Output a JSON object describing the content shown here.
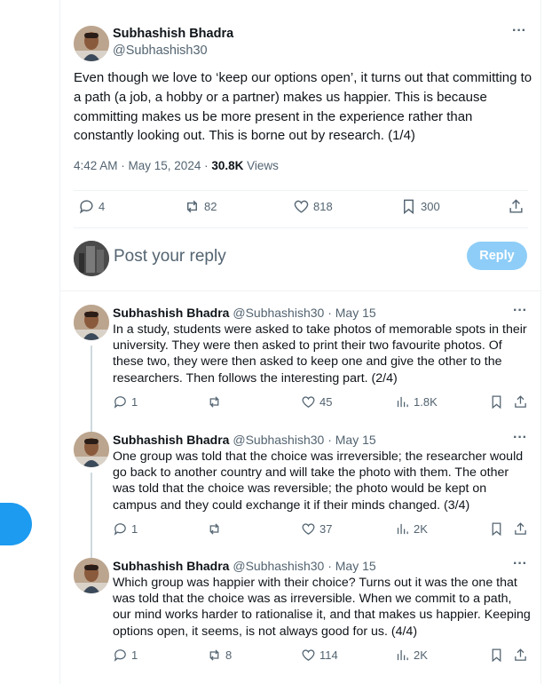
{
  "main_tweet": {
    "author_name": "Subhashish Bhadra",
    "author_handle": "@Subhashish30",
    "text": "Even though we love to ‘keep our options open’, it turns out that committing to a path (a job, a hobby or a partner) makes us happier. This is because committing makes us be more present in the experience rather than constantly looking out. This is borne out by research. (1/4)",
    "time": "4:42 AM · May 15, 2024 · ",
    "views_count": "30.8K",
    "views_label": " Views",
    "stats": {
      "replies": "4",
      "reposts": "82",
      "likes": "818",
      "bookmarks": "300"
    },
    "more_icon": "more-dots-icon"
  },
  "composer": {
    "placeholder": "Post your reply",
    "reply_button": "Reply"
  },
  "replies": [
    {
      "author_name": "Subhashish Bhadra",
      "meta": " @Subhashish30 · May 15",
      "text": "In a study, students were asked to take photos of memorable spots in their university. They were then asked to print their two favourite photos. Of these two, they were then asked to keep one and give the other to the researchers. Then follows the interesting part. (2/4)",
      "replies": "1",
      "reposts": "",
      "likes": "45",
      "views": "1.8K"
    },
    {
      "author_name": "Subhashish Bhadra",
      "meta": " @Subhashish30 · May 15",
      "text": "One group was told that the choice was irreversible; the researcher would go back to another country and will take the photo with them. The other was told that the choice was reversible; the photo would be kept on campus and they could exchange it if their minds changed. (3/4)",
      "replies": "1",
      "reposts": "",
      "likes": "37",
      "views": "2K"
    },
    {
      "author_name": "Subhashish Bhadra",
      "meta": " @Subhashish30 · May 15",
      "text": "Which group was happier with their choice? Turns out it was the one that was told that the choice was as irreversible. When we commit to a path, our mind works harder to rationalise it, and that makes us happier. Keeping options open, it seems, is not always good for us. (4/4)",
      "replies": "1",
      "reposts": "8",
      "likes": "114",
      "views": "2K"
    }
  ],
  "colors": {
    "accent": "#1d9bf0",
    "reply_button_disabled": "#8ecdf8",
    "muted": "#536471"
  }
}
